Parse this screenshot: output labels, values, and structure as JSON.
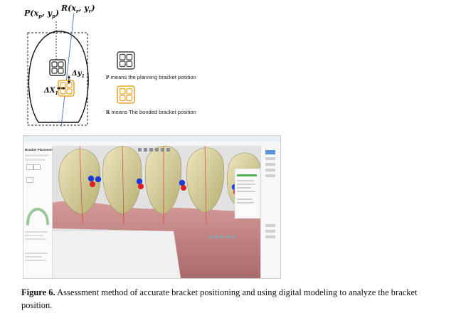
{
  "diagram": {
    "label_p": "P(x",
    "label_p_sub": "p",
    "label_p_mid": ", y",
    "label_p_sub2": "p",
    "label_p_end": ")",
    "label_r": "R(x",
    "label_r_sub": "r",
    "label_r_mid": ", y",
    "label_r_sub2": "r",
    "label_r_end": ")",
    "delta_y": "Δy",
    "delta_y_sub": "1",
    "delta_x": "ΔX",
    "delta_x_sub": "1"
  },
  "legend": {
    "planning_letter": "P",
    "planning_text": " means the planning bracket position",
    "bonded_letter": "R",
    "bonded_text": " means The bonded bracket position",
    "planning_color": "#444444",
    "bonded_color": "#e8a42a"
  },
  "software": {
    "panel_title": "Bracket Placement",
    "colors": {
      "gum": "#c98a8a",
      "tooth": "#ddd4a0",
      "marker_red": "#e02020",
      "marker_blue": "#1f3cd6",
      "guide_line": "#d03030"
    }
  },
  "caption": {
    "label": "Figure 6.",
    "text": " Assessment method of accurate bracket positioning and using digital modeling to analyze the bracket position."
  }
}
